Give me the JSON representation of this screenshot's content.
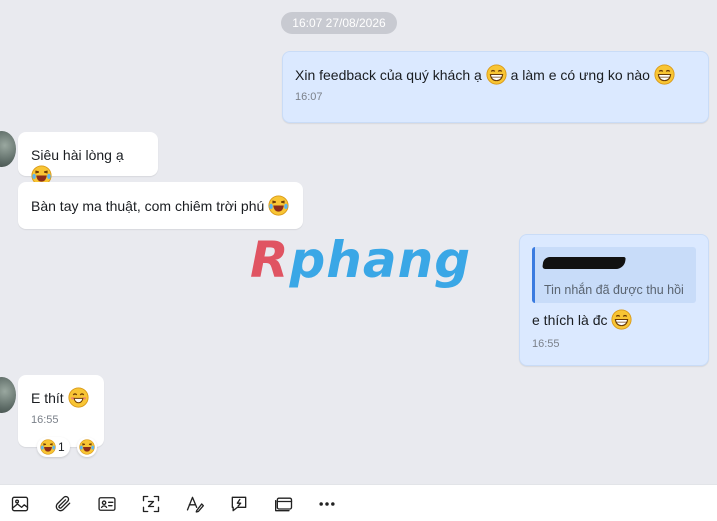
{
  "chat": {
    "timestamp_divider": "16:07 27/08/2026",
    "messages": [
      {
        "direction": "out",
        "text_part1": "Xin feedback của quý khách ạ",
        "text_part2": "a làm e có ưng ko nào",
        "time": "16:07"
      },
      {
        "direction": "in",
        "text": "Siêu hài lòng ạ"
      },
      {
        "direction": "in",
        "text": "Bàn tay ma thuật, com chiêm trời phú"
      },
      {
        "direction": "out",
        "quote_text": "Tin nhắn đã được thu hồi",
        "text": "e thích là đc",
        "time": "16:55"
      },
      {
        "direction": "in",
        "text": "E thít",
        "time": "16:55",
        "reactions": [
          {
            "emoji": "laughing-crying",
            "count": "1"
          },
          {
            "emoji": "laughing-crying"
          }
        ]
      }
    ]
  },
  "watermark": {
    "first_letter": "R",
    "rest": "phang"
  },
  "toolbar": {
    "icons": [
      "image-icon",
      "attachment-icon",
      "contact-card-icon",
      "sleep-timer-icon",
      "text-format-icon",
      "quick-reply-icon",
      "card-icon",
      "more-icon"
    ]
  },
  "colors": {
    "background": "#e9eaef",
    "outgoing_bubble": "#dbe9ff",
    "incoming_bubble": "#ffffff",
    "quote_bar": "#3a7be0"
  }
}
